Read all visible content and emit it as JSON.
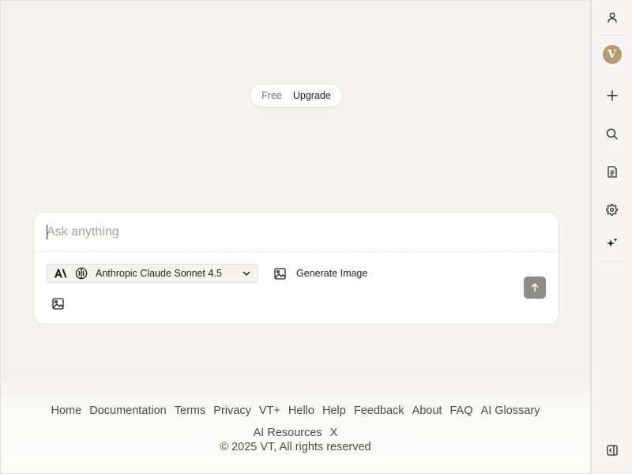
{
  "plan_toggle": {
    "free_label": "Free",
    "upgrade_label": "Upgrade"
  },
  "composer": {
    "placeholder": "Ask anything",
    "model_name": "Anthropic Claude Sonnet 4.5",
    "generate_image_label": "Generate Image"
  },
  "sidebar": {
    "avatar_initial": "V"
  },
  "footer": {
    "links": [
      {
        "label": "Home"
      },
      {
        "label": "Documentation"
      },
      {
        "label": "Terms"
      },
      {
        "label": "Privacy"
      },
      {
        "label": "VT+"
      },
      {
        "label": "Hello"
      },
      {
        "label": "Help"
      },
      {
        "label": "Feedback"
      },
      {
        "label": "About"
      },
      {
        "label": "FAQ"
      },
      {
        "label": "AI Glossary"
      },
      {
        "label": "AI Resources"
      },
      {
        "label": "X"
      }
    ],
    "copyright": "© 2025 VT, All rights reserved"
  },
  "colors": {
    "background": "#f4f3f1",
    "send_button": "#8f8d89",
    "avatar": "#b39a70"
  }
}
